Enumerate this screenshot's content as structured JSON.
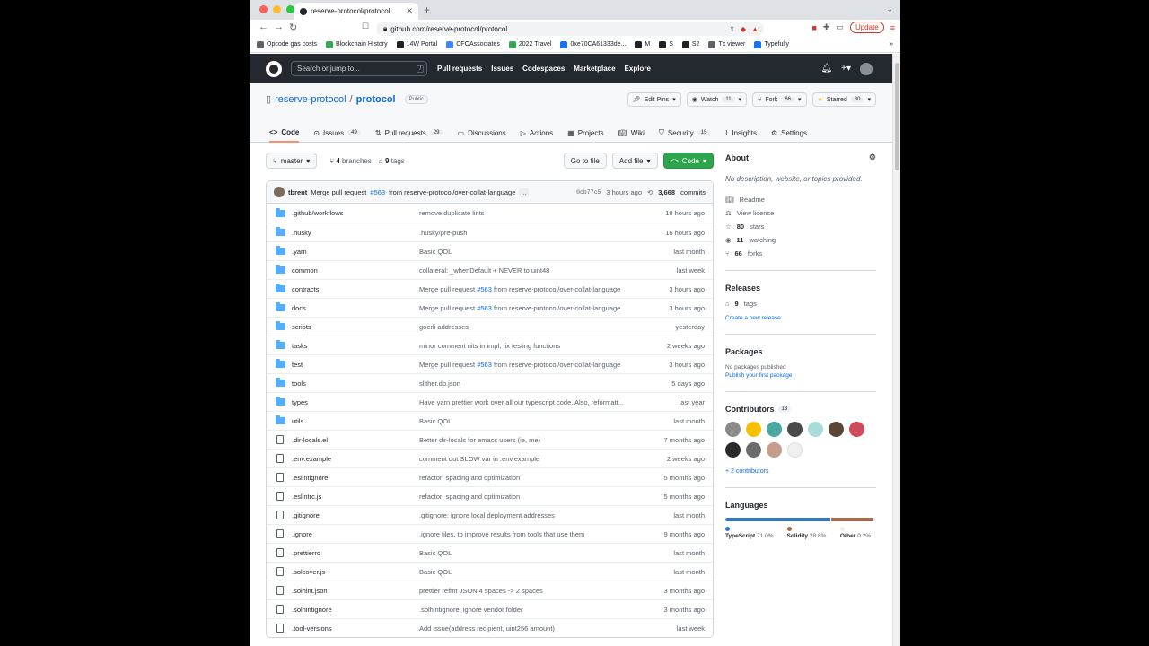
{
  "browser": {
    "tab_title": "reserve-protocol/protocol",
    "url": "github.com/reserve-protocol/protocol",
    "update_label": "Update",
    "bookmarks": [
      "Opcode gas costs",
      "Blockchain History",
      "14W Portal",
      "CFOAssociates",
      "2022 Travel",
      "0xe70CA61333de...",
      "M",
      "S",
      "S2",
      "Tx viewer",
      "Typefully"
    ]
  },
  "github": {
    "search_placeholder": "Search or jump to...",
    "search_key": "/",
    "nav": [
      "Pull requests",
      "Issues",
      "Codespaces",
      "Marketplace",
      "Explore"
    ]
  },
  "repo": {
    "owner": "reserve-protocol",
    "sep": "/",
    "name": "protocol",
    "visibility": "Public",
    "edit_pins": "Edit Pins",
    "watch": "Watch",
    "watch_count": "11",
    "fork": "Fork",
    "fork_count": "66",
    "starred": "Starred",
    "star_count": "80",
    "tabs": [
      {
        "label": "Code",
        "count": ""
      },
      {
        "label": "Issues",
        "count": "49"
      },
      {
        "label": "Pull requests",
        "count": "29"
      },
      {
        "label": "Discussions",
        "count": ""
      },
      {
        "label": "Actions",
        "count": ""
      },
      {
        "label": "Projects",
        "count": ""
      },
      {
        "label": "Wiki",
        "count": ""
      },
      {
        "label": "Security",
        "count": "15"
      },
      {
        "label": "Insights",
        "count": ""
      },
      {
        "label": "Settings",
        "count": ""
      }
    ]
  },
  "filebar": {
    "branch": "master",
    "branches_num": "4",
    "branches_label": "branches",
    "tags_num": "9",
    "tags_label": "tags",
    "goto_file": "Go to file",
    "add_file": "Add file",
    "code": "Code"
  },
  "commit": {
    "author": "tbrent",
    "msg_prefix": "Merge pull request",
    "pr": "#563",
    "msg_suffix": "from reserve-protocol/over-collat-language",
    "ellipsis": "...",
    "sha": "0cb77c5",
    "age": "3 hours ago",
    "count": "3,668",
    "count_label": "commits"
  },
  "files": [
    {
      "name": ".github/workflows",
      "type": "dir",
      "msg_a": "remove duplicate lints",
      "pr": "",
      "msg_b": "",
      "age": "18 hours ago"
    },
    {
      "name": ".husky",
      "type": "dir",
      "msg_a": ".husky/pre-push",
      "pr": "",
      "msg_b": "",
      "age": "16 hours ago"
    },
    {
      "name": ".yarn",
      "type": "dir",
      "msg_a": "Basic QOL",
      "pr": "",
      "msg_b": "",
      "age": "last month"
    },
    {
      "name": "common",
      "type": "dir",
      "msg_a": "collateral: _whenDefault + NEVER to uint48",
      "pr": "",
      "msg_b": "",
      "age": "last week"
    },
    {
      "name": "contracts",
      "type": "dir",
      "msg_a": "Merge pull request ",
      "pr": "#563",
      "msg_b": " from reserve-protocol/over-collat-language",
      "age": "3 hours ago"
    },
    {
      "name": "docs",
      "type": "dir",
      "msg_a": "Merge pull request ",
      "pr": "#563",
      "msg_b": " from reserve-protocol/over-collat-language",
      "age": "3 hours ago"
    },
    {
      "name": "scripts",
      "type": "dir",
      "msg_a": "goerli addresses",
      "pr": "",
      "msg_b": "",
      "age": "yesterday"
    },
    {
      "name": "tasks",
      "type": "dir",
      "msg_a": "minor comment nits in impl; fix testing functions",
      "pr": "",
      "msg_b": "",
      "age": "2 weeks ago"
    },
    {
      "name": "test",
      "type": "dir",
      "msg_a": "Merge pull request ",
      "pr": "#563",
      "msg_b": " from reserve-protocol/over-collat-language",
      "age": "3 hours ago"
    },
    {
      "name": "tools",
      "type": "dir",
      "msg_a": "slither.db.json",
      "pr": "",
      "msg_b": "",
      "age": "5 days ago"
    },
    {
      "name": "types",
      "type": "dir",
      "msg_a": "Have yarn prettier work over all our typescript code. Also, reformatt...",
      "pr": "",
      "msg_b": "",
      "age": "last year"
    },
    {
      "name": "utils",
      "type": "dir",
      "msg_a": "Basic QOL",
      "pr": "",
      "msg_b": "",
      "age": "last month"
    },
    {
      "name": ".dir-locals.el",
      "type": "file",
      "msg_a": "Better dir-locals for emacs users (ie, me)",
      "pr": "",
      "msg_b": "",
      "age": "7 months ago"
    },
    {
      "name": ".env.example",
      "type": "file",
      "msg_a": "comment out SLOW var in .env.example",
      "pr": "",
      "msg_b": "",
      "age": "2 weeks ago"
    },
    {
      "name": ".eslintignore",
      "type": "file",
      "msg_a": "refactor: spacing and optimization",
      "pr": "",
      "msg_b": "",
      "age": "5 months ago"
    },
    {
      "name": ".eslintrc.js",
      "type": "file",
      "msg_a": "refactor: spacing and optimization",
      "pr": "",
      "msg_b": "",
      "age": "5 months ago"
    },
    {
      "name": ".gitignore",
      "type": "file",
      "msg_a": ".gitignore: ignore local deployment addresses",
      "pr": "",
      "msg_b": "",
      "age": "last month"
    },
    {
      "name": ".ignore",
      "type": "file",
      "msg_a": ".ignore files, to improve results from tools that use them",
      "pr": "",
      "msg_b": "",
      "age": "9 months ago"
    },
    {
      "name": ".prettierrc",
      "type": "file",
      "msg_a": "Basic QOL",
      "pr": "",
      "msg_b": "",
      "age": "last month"
    },
    {
      "name": ".solcover.js",
      "type": "file",
      "msg_a": "Basic QOL",
      "pr": "",
      "msg_b": "",
      "age": "last month"
    },
    {
      "name": ".solhint.json",
      "type": "file",
      "msg_a": "prettier refmt JSON 4 spaces -> 2 spaces",
      "pr": "",
      "msg_b": "",
      "age": "3 months ago"
    },
    {
      "name": ".solhintignore",
      "type": "file",
      "msg_a": ".solhintignore: ignore vendor folder",
      "pr": "",
      "msg_b": "",
      "age": "3 months ago"
    },
    {
      "name": ".tool-versions",
      "type": "file",
      "msg_a": "Add issue(address recipient, uint256 amount)",
      "pr": "",
      "msg_b": "",
      "age": "last week"
    }
  ],
  "sidebar": {
    "about": "About",
    "description": "No description, website, or topics provided.",
    "readme": "Readme",
    "license": "View license",
    "stars_num": "80",
    "stars_label": "stars",
    "watching_num": "11",
    "watching_label": "watching",
    "forks_num": "66",
    "forks_label": "forks",
    "releases": "Releases",
    "rel_tags_num": "9",
    "rel_tags_label": "tags",
    "create_release": "Create a new release",
    "packages": "Packages",
    "no_packages": "No packages published",
    "publish_package": "Publish your first package",
    "contributors": "Contributors",
    "contributors_count": "13",
    "more_contributors": "+ 2 contributors",
    "languages": "Languages",
    "langs": [
      {
        "name": "TypeScript",
        "pct": "71.0%",
        "value": 71.0,
        "color": "#3178c6"
      },
      {
        "name": "Solidity",
        "pct": "28.8%",
        "value": 28.8,
        "color": "#aa6746"
      },
      {
        "name": "Other",
        "pct": "0.2%",
        "value": 0.2,
        "color": "#ededed"
      }
    ]
  },
  "colors": {
    "link": "#0969da",
    "green_button": "#2da44e",
    "header_bg": "#24292f",
    "folder": "#54aeff"
  }
}
